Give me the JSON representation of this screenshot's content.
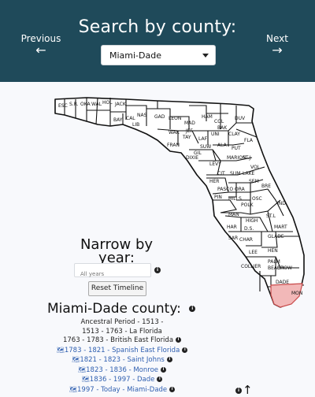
{
  "header": {
    "title": "Search by county:",
    "prev_label": "Previous",
    "next_label": "Next",
    "prev_arrow": "←",
    "next_arrow": "→",
    "selected_county": "Miami-Dade"
  },
  "colors": {
    "header_bg": "#1f4a5a",
    "selected_county_fill": "#f2b8b8",
    "link": "#2f5fb0"
  },
  "map": {
    "labels": [
      "ESC",
      "S.R.",
      "OKA",
      "WAL",
      "HOL",
      "JACK",
      "NAS",
      "BAY",
      "CAL",
      "LIB",
      "GAD",
      "LEON",
      "MAD",
      "HAM",
      "COL",
      "BAK",
      "DUV",
      "WAK",
      "JEF",
      "TAY",
      "LAF",
      "SUW",
      "UNI",
      "CLAY",
      "FRAN",
      "GIL",
      "ALA",
      "PUT",
      "FLA",
      "DIXIE",
      "MARION",
      "ST.J",
      "LEVY",
      "VOL",
      "CIT",
      "SUM",
      "LAKE",
      "HER",
      "SEM",
      "PASCO",
      "ORA",
      "BRE",
      "PIN",
      "HILLS",
      "POLK",
      "OSC",
      "IND",
      "MAN",
      "HAR",
      "D.S.",
      "HIGH",
      "ST.L",
      "SAR",
      "MART",
      "CHAR",
      "GLADE",
      "LEE",
      "HEN",
      "PALM BEACH",
      "BROW",
      "COLLIER",
      "DADE",
      "MON"
    ]
  },
  "timeline": {
    "heading": "Narrow by year:",
    "input_placeholder": "All years",
    "reset_label": "Reset Timeline",
    "info_icon": "i"
  },
  "county_section": {
    "title": "Miami-Dade county:",
    "entries": [
      {
        "text": "Ancestral Period - 1513 -",
        "link": false,
        "info": false
      },
      {
        "text": "1513 - 1763 - La Florida",
        "link": false,
        "info": false
      },
      {
        "text": "1763 - 1783 - British East Florida",
        "link": false,
        "info": true
      },
      {
        "text": "1783 - 1821 - Spanish East Florida",
        "link": true,
        "info": true
      },
      {
        "text": "1821 - 1823 - Saint Johns",
        "link": true,
        "info": true
      },
      {
        "text": "1823 - 1836 - Monroe",
        "link": true,
        "info": true
      },
      {
        "text": "1836 - 1997 - Dade",
        "link": true,
        "info": true
      },
      {
        "text": "1997 - Today - Miami-Dade",
        "link": true,
        "info": true
      }
    ]
  },
  "footer": {
    "up_arrow": "↑"
  }
}
